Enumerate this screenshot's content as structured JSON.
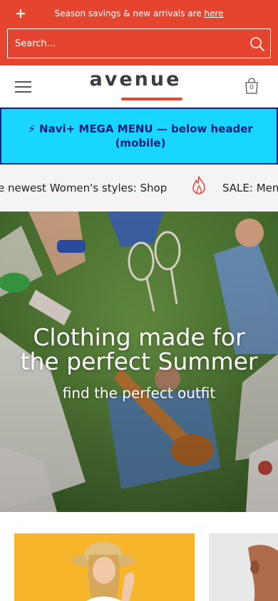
{
  "announcement": {
    "plus_icon": "plus-icon",
    "text": "Season savings & new arrivals are ",
    "link_label": "here"
  },
  "search": {
    "placeholder": "Search...",
    "icon": "search-icon"
  },
  "header": {
    "menu_icon": "hamburger-menu-icon",
    "logo": "avenue",
    "cart_count": "0",
    "cart_icon": "shopping-bag-icon"
  },
  "mega_menu": {
    "icon": "⚡",
    "text": "Navi+ MEGA MENU — below header (mobile)"
  },
  "ticker": {
    "item_1": "e newest Women's styles:  Shop",
    "icon": "flame-icon",
    "item_2": "SALE: Men"
  },
  "hero": {
    "title_line_1": "Clothing made for",
    "title_line_2": "the perfect Summer",
    "subtitle": "find the perfect outfit"
  },
  "colors": {
    "accent": "#e5442f",
    "mega_bg": "#18d6ff",
    "mega_text": "#0b1e78",
    "ticker_bg": "#f4f4f4",
    "card_1_bg": "#f7b52b"
  }
}
